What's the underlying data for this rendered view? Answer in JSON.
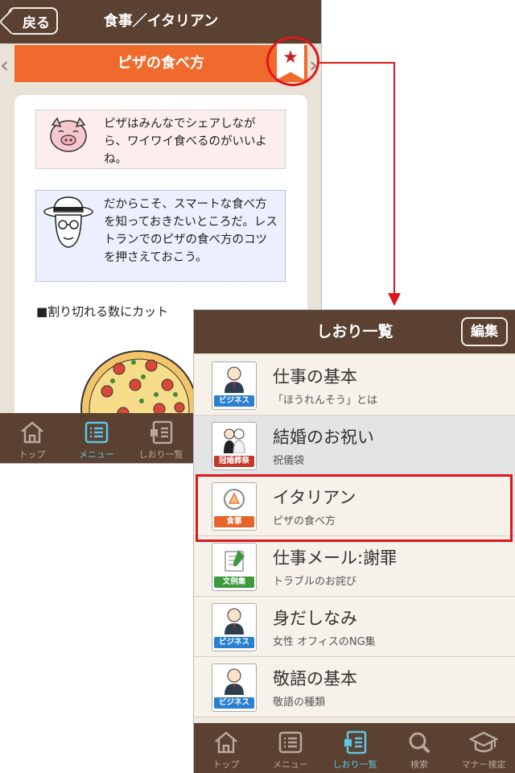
{
  "detail": {
    "back_label": "戻る",
    "title": "食事／イタリアン",
    "section_title": "ピザの食べ方",
    "bubble1": "ピザはみんなでシェアしながら、ワイワイ食べるのがいいよね。",
    "bubble2": "だからこそ、スマートな食べ方を知っておきたいところだ。レストランでのピザの食べ方のコツを押さえておこう。",
    "heading": "■割り切れる数にカット",
    "tabs": [
      "トップ",
      "メニュー",
      "しおり一覧"
    ]
  },
  "bookmarks": {
    "title": "しおり一覧",
    "edit_label": "編集",
    "items": [
      {
        "title": "仕事の基本",
        "sub": "「ほうれんそう」とは",
        "badge": "ビジネス",
        "badge_color": "#2a7fd0"
      },
      {
        "title": "結婚のお祝い",
        "sub": "祝儀袋",
        "badge": "冠婚葬祭",
        "badge_color": "#c0392b"
      },
      {
        "title": "イタリアン",
        "sub": "ピザの食べ方",
        "badge": "食事",
        "badge_color": "#e5652a"
      },
      {
        "title": "仕事メール:謝罪",
        "sub": "トラブルのお詫び",
        "badge": "文例集",
        "badge_color": "#3c9a3c"
      },
      {
        "title": "身だしなみ",
        "sub": "女性 オフィスのNG集",
        "badge": "ビジネス",
        "badge_color": "#2a7fd0"
      },
      {
        "title": "敬語の基本",
        "sub": "敬語の種類",
        "badge": "ビジネス",
        "badge_color": "#2a7fd0"
      }
    ],
    "tabs": [
      "トップ",
      "メニュー",
      "しおり一覧",
      "検索",
      "マナー検定"
    ]
  },
  "colors": {
    "accent": "#ef6a2c",
    "bar": "#5a4132",
    "active_tab": "#5ec6e4",
    "callout": "#e1161c"
  }
}
